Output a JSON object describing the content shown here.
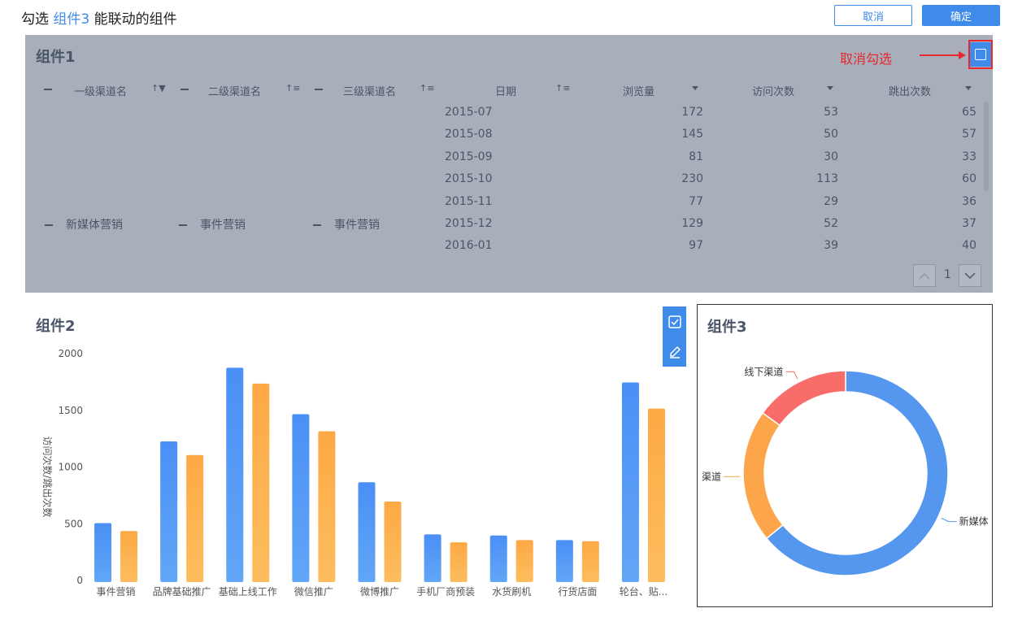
{
  "header": {
    "title_prefix": "勾选 ",
    "title_highlight": "组件3",
    "title_suffix": " 能联动的组件",
    "cancel_label": "取消",
    "confirm_label": "确定"
  },
  "colors": {
    "accent": "#3e8be9",
    "bar_blue": "#5b9cf5",
    "bar_orange": "#fdb150",
    "annotation_red": "#e8282d"
  },
  "widget1": {
    "title": "组件1",
    "annotation": "取消勾选",
    "columns": [
      {
        "label": "一级渠道名"
      },
      {
        "label": "二级渠道名"
      },
      {
        "label": "三级渠道名"
      },
      {
        "label": "日期"
      },
      {
        "label": "浏览量"
      },
      {
        "label": "访问次数"
      },
      {
        "label": "跳出次数"
      }
    ],
    "group": {
      "level1": "新媒体营销",
      "level2": "事件营销",
      "level3": "事件营销"
    },
    "rows": [
      {
        "date": "2015-07",
        "views": "172",
        "visits": "53",
        "bounces": "65"
      },
      {
        "date": "2015-08",
        "views": "145",
        "visits": "50",
        "bounces": "57"
      },
      {
        "date": "2015-09",
        "views": "81",
        "visits": "30",
        "bounces": "33"
      },
      {
        "date": "2015-10",
        "views": "230",
        "visits": "113",
        "bounces": "60"
      },
      {
        "date": "2015-11",
        "views": "77",
        "visits": "29",
        "bounces": "36"
      },
      {
        "date": "2015-12",
        "views": "129",
        "visits": "52",
        "bounces": "37"
      },
      {
        "date": "2016-01",
        "views": "97",
        "visits": "39",
        "bounces": "40"
      }
    ],
    "page_number": "1"
  },
  "widget2": {
    "title": "组件2"
  },
  "widget3": {
    "title": "组件3"
  },
  "chart_data": [
    {
      "type": "bar",
      "ylabel": "访问次数/跳出次数",
      "ylim": [
        0,
        2000
      ],
      "yticks": [
        "0",
        "500",
        "1000",
        "1500",
        "2000"
      ],
      "categories": [
        "事件营销",
        "品牌基础推广",
        "基础上线工作",
        "微信推广",
        "微博推广",
        "手机厂商预装",
        "水货刷机",
        "行货店面",
        "轮台、贴..."
      ],
      "series": [
        {
          "values": [
            520,
            1240,
            1890,
            1480,
            880,
            420,
            410,
            370,
            1760
          ]
        },
        {
          "values": [
            450,
            1120,
            1750,
            1330,
            710,
            350,
            370,
            360,
            1530
          ]
        }
      ]
    },
    {
      "type": "pie",
      "donut": true,
      "slices": [
        {
          "label": "新媒体",
          "value": 64,
          "color": "#5596ef"
        },
        {
          "label": "渠道",
          "value": 21,
          "color": "#fca54a"
        },
        {
          "label": "线下渠道",
          "value": 15,
          "color": "#f86c6a"
        }
      ]
    }
  ]
}
